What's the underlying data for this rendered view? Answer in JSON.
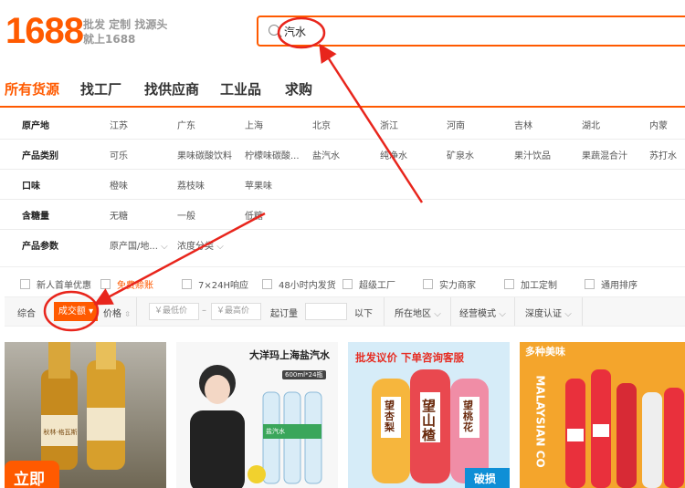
{
  "header": {
    "logo": "1688",
    "slogan_line1": "批发 定制 找源头",
    "slogan_line2": "就上1688",
    "search_value": "汽水"
  },
  "nav": {
    "items": [
      "所有货源",
      "找工厂",
      "找供应商",
      "工业品",
      "求购"
    ],
    "active_index": 0
  },
  "filters": [
    {
      "label": "原产地",
      "values": [
        "江苏",
        "广东",
        "上海",
        "北京",
        "浙江",
        "河南",
        "吉林",
        "湖北",
        "内蒙"
      ]
    },
    {
      "label": "产品类别",
      "values": [
        "可乐",
        "果味碳酸饮料",
        "柠檬味碳酸...",
        "盐汽水",
        "纯净水",
        "矿泉水",
        "果汁饮品",
        "果蔬混合汁",
        "苏打水"
      ]
    },
    {
      "label": "口味",
      "values": [
        "橙味",
        "荔枝味",
        "苹果味"
      ]
    },
    {
      "label": "含糖量",
      "values": [
        "无糖",
        "一般",
        "低糖"
      ]
    },
    {
      "label": "产品参数",
      "values": [
        "原产国/地...",
        "浓度分类"
      ]
    }
  ],
  "checkboxes": [
    "新人首单优惠",
    "免费赊账",
    "7×24H响应",
    "48小时内发货",
    "超级工厂",
    "实力商家",
    "加工定制",
    "通用排序"
  ],
  "sortbar": {
    "comprehensive": "综合",
    "volume": "成交额",
    "price": "价格",
    "min_price": "￥最低价",
    "dash": "–",
    "max_price": "￥最高价",
    "moq_label": "起订量",
    "below": "以下",
    "region": "所在地区",
    "mode": "经营模式",
    "depth": "深度认证"
  },
  "products": [
    {
      "overlay_text": "立即",
      "bottle_text": "秋林·格瓦斯"
    },
    {
      "title": "大洋玛上海盐汽水",
      "subtitle": "600ml*24瓶",
      "bottle_text": "盐汽水"
    },
    {
      "banner": "批发议价 下单咨询客服",
      "bottle1": "望杏梨",
      "bottle2": "望山楂",
      "bottle3": "望桃花",
      "corner": "破损"
    },
    {
      "banner": "多种美味",
      "side_text": "MALAYSIAN CO",
      "brand": "cola"
    }
  ],
  "colors": {
    "accent": "#ff5a00",
    "annotation": "#e8251c"
  }
}
